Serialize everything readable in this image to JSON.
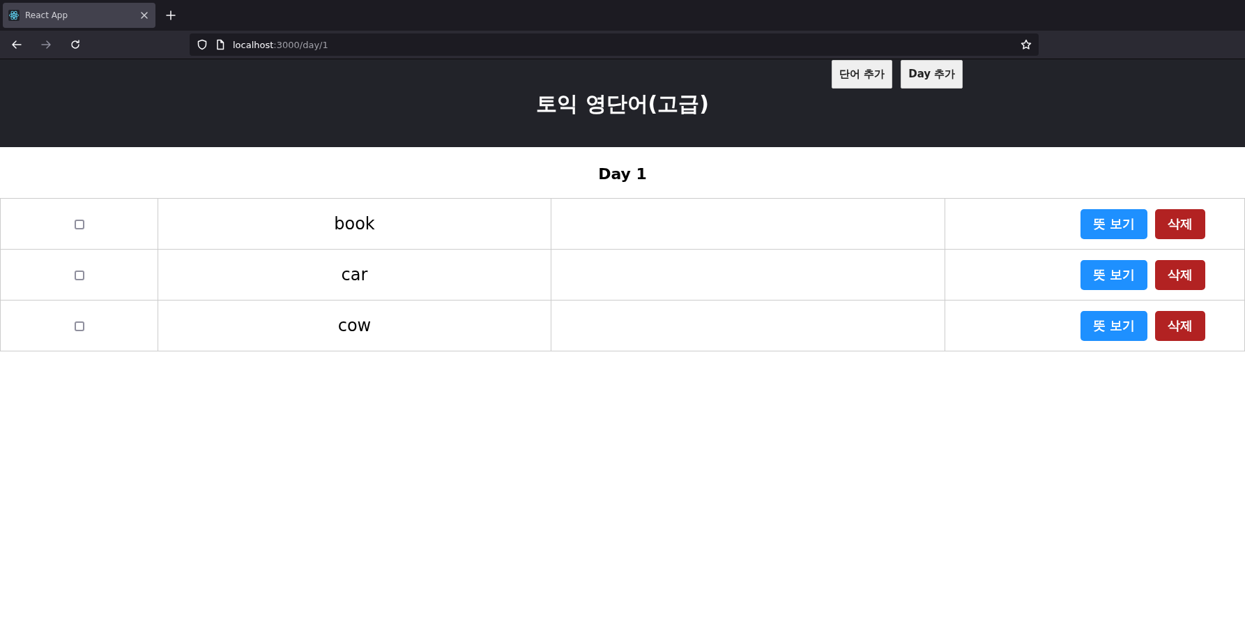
{
  "browser": {
    "tab": {
      "title": "React App",
      "selected": true
    },
    "url_host": "localhost",
    "url_path": ":3000/day/1"
  },
  "header": {
    "title": "토익 영단어(고급)",
    "menu": [
      "단어 추가",
      "Day 추가"
    ]
  },
  "day_title": "Day 1",
  "words": [
    {
      "word": "book",
      "checked": false,
      "buttons": [
        "뜻 보기",
        "삭제"
      ]
    },
    {
      "word": "car",
      "checked": false,
      "buttons": [
        "뜻 보기",
        "삭제"
      ]
    },
    {
      "word": "cow",
      "checked": false,
      "buttons": [
        "뜻 보기",
        "삭제"
      ]
    }
  ]
}
